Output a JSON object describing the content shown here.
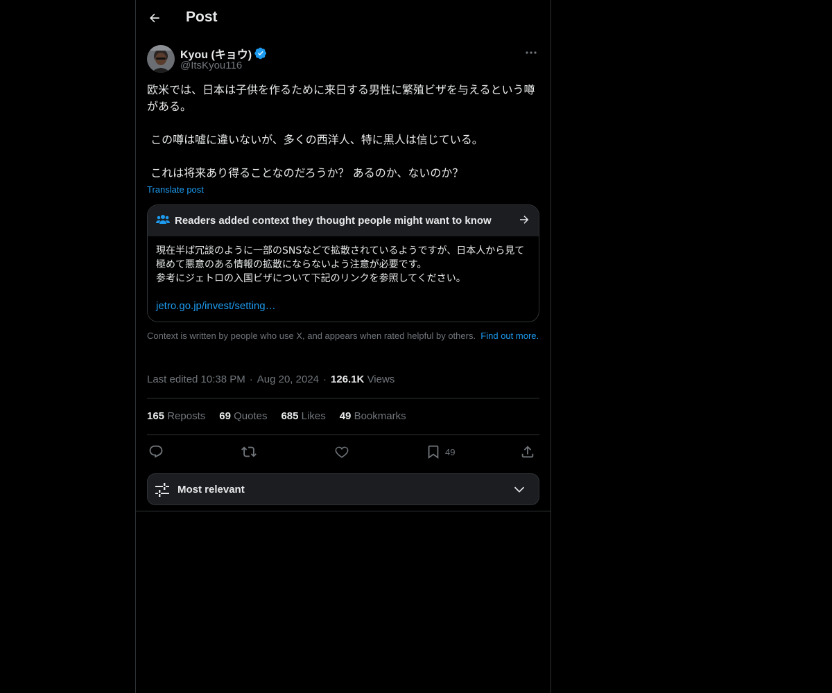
{
  "header": {
    "title": "Post",
    "back_icon": "arrow-left-icon"
  },
  "author": {
    "display_name": "Kyou (キョウ)",
    "handle": "@ItsKyou116",
    "verified": true,
    "verified_color": "#1d9bf0"
  },
  "post": {
    "text": "欧米では、日本は子供を作るために来日する男性に繁殖ビザを与えるという噂がある。\n\n この噂は嘘に違いないが、多くの西洋人、特に黒人は信じている。\n\n これは将来あり得ることなのだろうか？ あるのか、ないのか？",
    "translate_label": "Translate post"
  },
  "community_note": {
    "title": "Readers added context they thought people might want to know",
    "body": "現在半ば冗談のように一部のSNSなどで拡散されているようですが、日本人から見て極めて悪意のある情報の拡散にならないよう注意が必要です。\n参考にジェトロの入国ビザについて下記のリンクを参照してください。",
    "link": "jetro.go.jp/invest/setting…",
    "icon": "people-icon"
  },
  "context_info": {
    "text": "Context is written by people who use X, and appears when rated helpful by others.",
    "find_out": "Find out more."
  },
  "meta": {
    "edited": "Last edited 10:38 PM",
    "separator": "·",
    "date": "Aug 20, 2024",
    "views_count": "126.1K",
    "views_label": "Views"
  },
  "stats": [
    {
      "count": "165",
      "label": "Reposts"
    },
    {
      "count": "69",
      "label": "Quotes"
    },
    {
      "count": "685",
      "label": "Likes"
    },
    {
      "count": "49",
      "label": "Bookmarks"
    }
  ],
  "actions": {
    "bookmark_count": "49"
  },
  "sort": {
    "label": "Most relevant"
  },
  "colors": {
    "background": "#000000",
    "text": "#e7e9ea",
    "muted": "#71767b",
    "accent": "#1d9bf0",
    "border": "#2f3336"
  }
}
